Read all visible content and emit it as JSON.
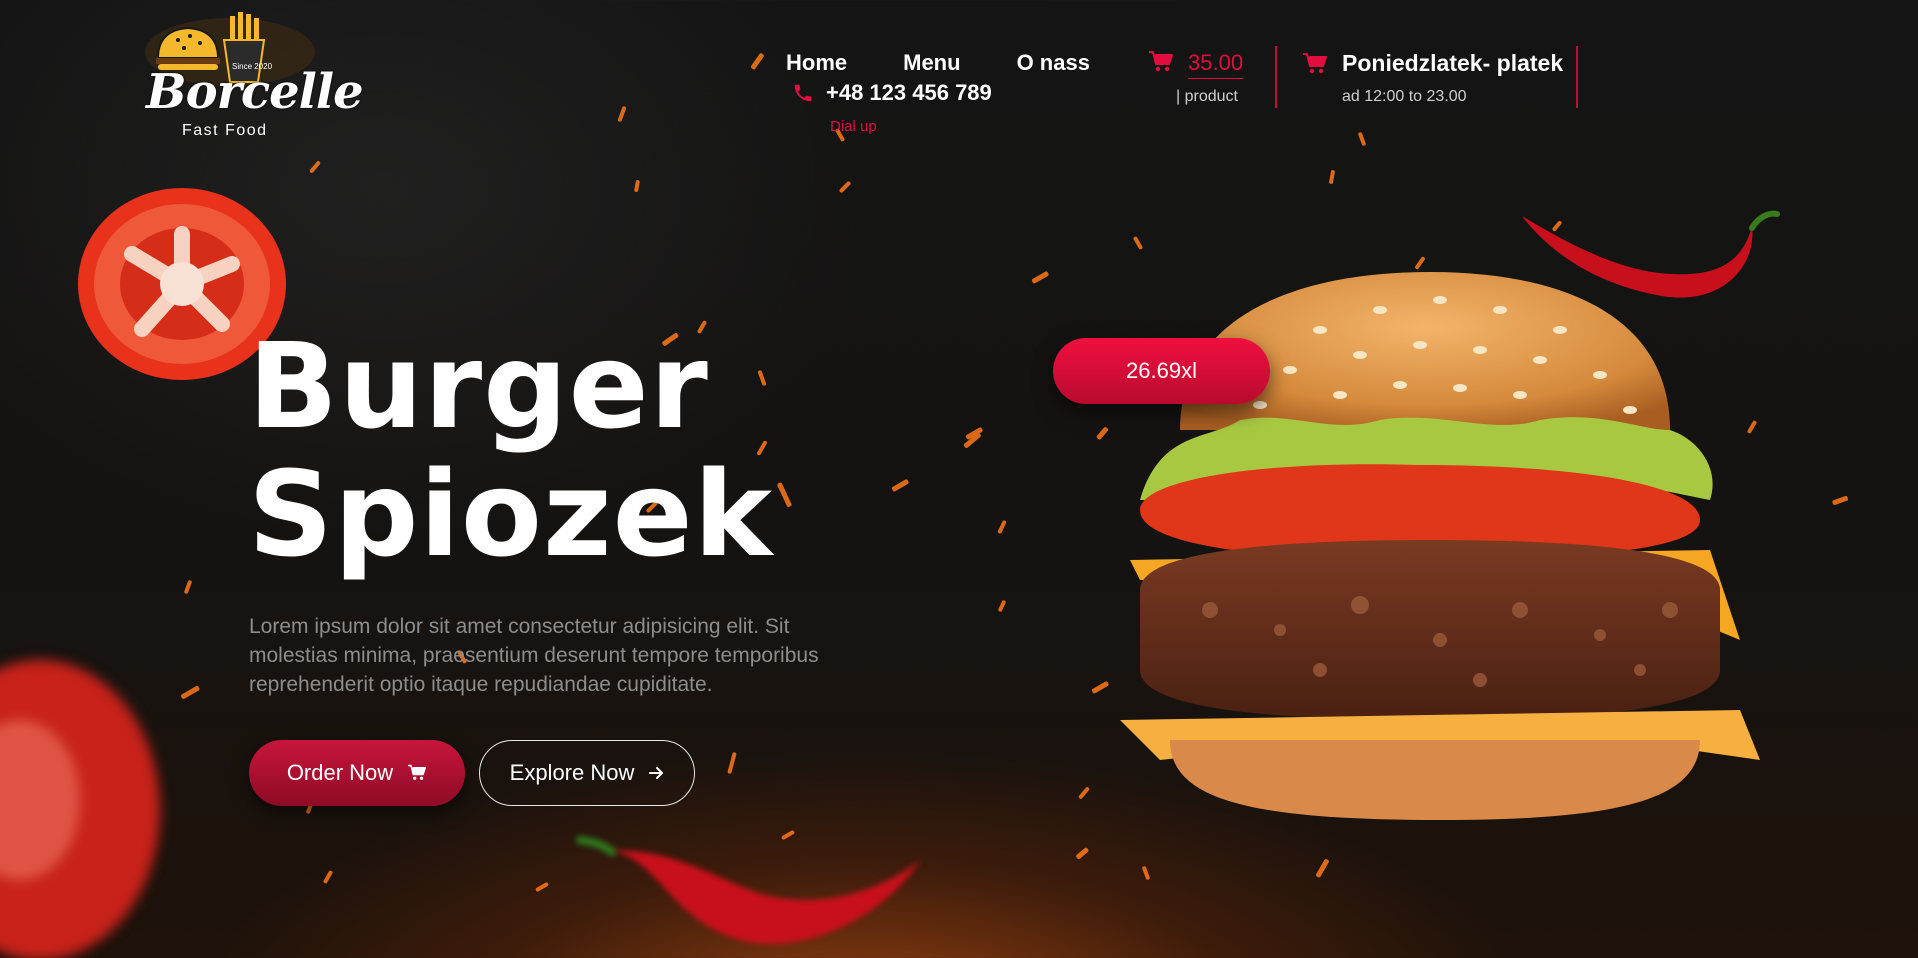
{
  "brand": {
    "name": "Borcelle",
    "tagline": "Fast Food",
    "badge": "Since 2020"
  },
  "nav": {
    "items": [
      {
        "label": "Home"
      },
      {
        "label": "Menu"
      },
      {
        "label": "O nass"
      }
    ]
  },
  "contact": {
    "phone": "+48 123 456 789",
    "phone_label": "Dial up"
  },
  "cart": {
    "price": "35.00",
    "sub": "| product"
  },
  "hours": {
    "title": "Poniedzlatek- platek",
    "sub": "ad 12:00 to 23.00"
  },
  "hero": {
    "title_line1": "Burger",
    "title_line2": "Spiozek",
    "text": "Lorem ipsum dolor sit amet consectetur adipisicing elit. Sit molestias minima, praesentium deserunt tempore temporibus reprehenderit optio itaque repudiandae cupiditate.",
    "order_label": "Order Now",
    "explore_label": "Explore Now",
    "price_tag": "26.69xl"
  },
  "colors": {
    "accent": "#e20d3f",
    "background": "#141414"
  },
  "icons": [
    "phone-icon",
    "cart-icon",
    "arrow-right-icon"
  ]
}
